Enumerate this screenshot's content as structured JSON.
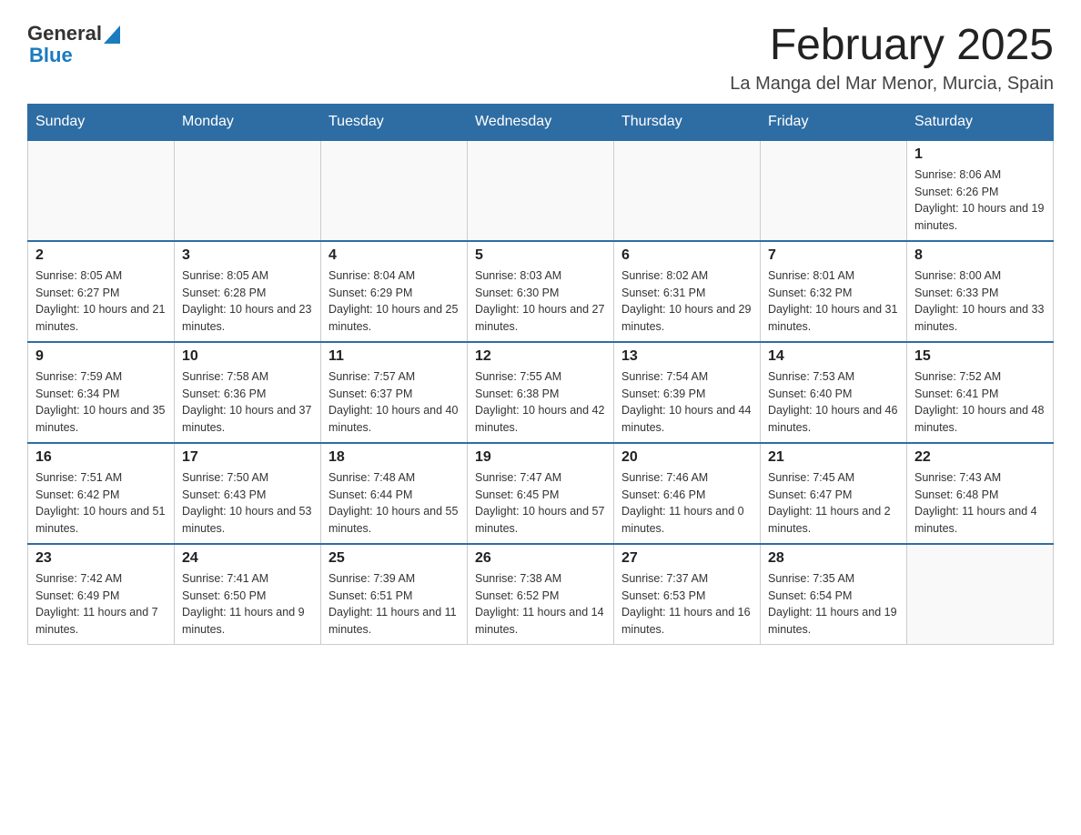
{
  "logo": {
    "general": "General",
    "blue": "Blue"
  },
  "header": {
    "month_year": "February 2025",
    "location": "La Manga del Mar Menor, Murcia, Spain"
  },
  "weekdays": [
    "Sunday",
    "Monday",
    "Tuesday",
    "Wednesday",
    "Thursday",
    "Friday",
    "Saturday"
  ],
  "weeks": [
    [
      {
        "day": "",
        "info": ""
      },
      {
        "day": "",
        "info": ""
      },
      {
        "day": "",
        "info": ""
      },
      {
        "day": "",
        "info": ""
      },
      {
        "day": "",
        "info": ""
      },
      {
        "day": "",
        "info": ""
      },
      {
        "day": "1",
        "info": "Sunrise: 8:06 AM\nSunset: 6:26 PM\nDaylight: 10 hours and 19 minutes."
      }
    ],
    [
      {
        "day": "2",
        "info": "Sunrise: 8:05 AM\nSunset: 6:27 PM\nDaylight: 10 hours and 21 minutes."
      },
      {
        "day": "3",
        "info": "Sunrise: 8:05 AM\nSunset: 6:28 PM\nDaylight: 10 hours and 23 minutes."
      },
      {
        "day": "4",
        "info": "Sunrise: 8:04 AM\nSunset: 6:29 PM\nDaylight: 10 hours and 25 minutes."
      },
      {
        "day": "5",
        "info": "Sunrise: 8:03 AM\nSunset: 6:30 PM\nDaylight: 10 hours and 27 minutes."
      },
      {
        "day": "6",
        "info": "Sunrise: 8:02 AM\nSunset: 6:31 PM\nDaylight: 10 hours and 29 minutes."
      },
      {
        "day": "7",
        "info": "Sunrise: 8:01 AM\nSunset: 6:32 PM\nDaylight: 10 hours and 31 minutes."
      },
      {
        "day": "8",
        "info": "Sunrise: 8:00 AM\nSunset: 6:33 PM\nDaylight: 10 hours and 33 minutes."
      }
    ],
    [
      {
        "day": "9",
        "info": "Sunrise: 7:59 AM\nSunset: 6:34 PM\nDaylight: 10 hours and 35 minutes."
      },
      {
        "day": "10",
        "info": "Sunrise: 7:58 AM\nSunset: 6:36 PM\nDaylight: 10 hours and 37 minutes."
      },
      {
        "day": "11",
        "info": "Sunrise: 7:57 AM\nSunset: 6:37 PM\nDaylight: 10 hours and 40 minutes."
      },
      {
        "day": "12",
        "info": "Sunrise: 7:55 AM\nSunset: 6:38 PM\nDaylight: 10 hours and 42 minutes."
      },
      {
        "day": "13",
        "info": "Sunrise: 7:54 AM\nSunset: 6:39 PM\nDaylight: 10 hours and 44 minutes."
      },
      {
        "day": "14",
        "info": "Sunrise: 7:53 AM\nSunset: 6:40 PM\nDaylight: 10 hours and 46 minutes."
      },
      {
        "day": "15",
        "info": "Sunrise: 7:52 AM\nSunset: 6:41 PM\nDaylight: 10 hours and 48 minutes."
      }
    ],
    [
      {
        "day": "16",
        "info": "Sunrise: 7:51 AM\nSunset: 6:42 PM\nDaylight: 10 hours and 51 minutes."
      },
      {
        "day": "17",
        "info": "Sunrise: 7:50 AM\nSunset: 6:43 PM\nDaylight: 10 hours and 53 minutes."
      },
      {
        "day": "18",
        "info": "Sunrise: 7:48 AM\nSunset: 6:44 PM\nDaylight: 10 hours and 55 minutes."
      },
      {
        "day": "19",
        "info": "Sunrise: 7:47 AM\nSunset: 6:45 PM\nDaylight: 10 hours and 57 minutes."
      },
      {
        "day": "20",
        "info": "Sunrise: 7:46 AM\nSunset: 6:46 PM\nDaylight: 11 hours and 0 minutes."
      },
      {
        "day": "21",
        "info": "Sunrise: 7:45 AM\nSunset: 6:47 PM\nDaylight: 11 hours and 2 minutes."
      },
      {
        "day": "22",
        "info": "Sunrise: 7:43 AM\nSunset: 6:48 PM\nDaylight: 11 hours and 4 minutes."
      }
    ],
    [
      {
        "day": "23",
        "info": "Sunrise: 7:42 AM\nSunset: 6:49 PM\nDaylight: 11 hours and 7 minutes."
      },
      {
        "day": "24",
        "info": "Sunrise: 7:41 AM\nSunset: 6:50 PM\nDaylight: 11 hours and 9 minutes."
      },
      {
        "day": "25",
        "info": "Sunrise: 7:39 AM\nSunset: 6:51 PM\nDaylight: 11 hours and 11 minutes."
      },
      {
        "day": "26",
        "info": "Sunrise: 7:38 AM\nSunset: 6:52 PM\nDaylight: 11 hours and 14 minutes."
      },
      {
        "day": "27",
        "info": "Sunrise: 7:37 AM\nSunset: 6:53 PM\nDaylight: 11 hours and 16 minutes."
      },
      {
        "day": "28",
        "info": "Sunrise: 7:35 AM\nSunset: 6:54 PM\nDaylight: 11 hours and 19 minutes."
      },
      {
        "day": "",
        "info": ""
      }
    ]
  ]
}
